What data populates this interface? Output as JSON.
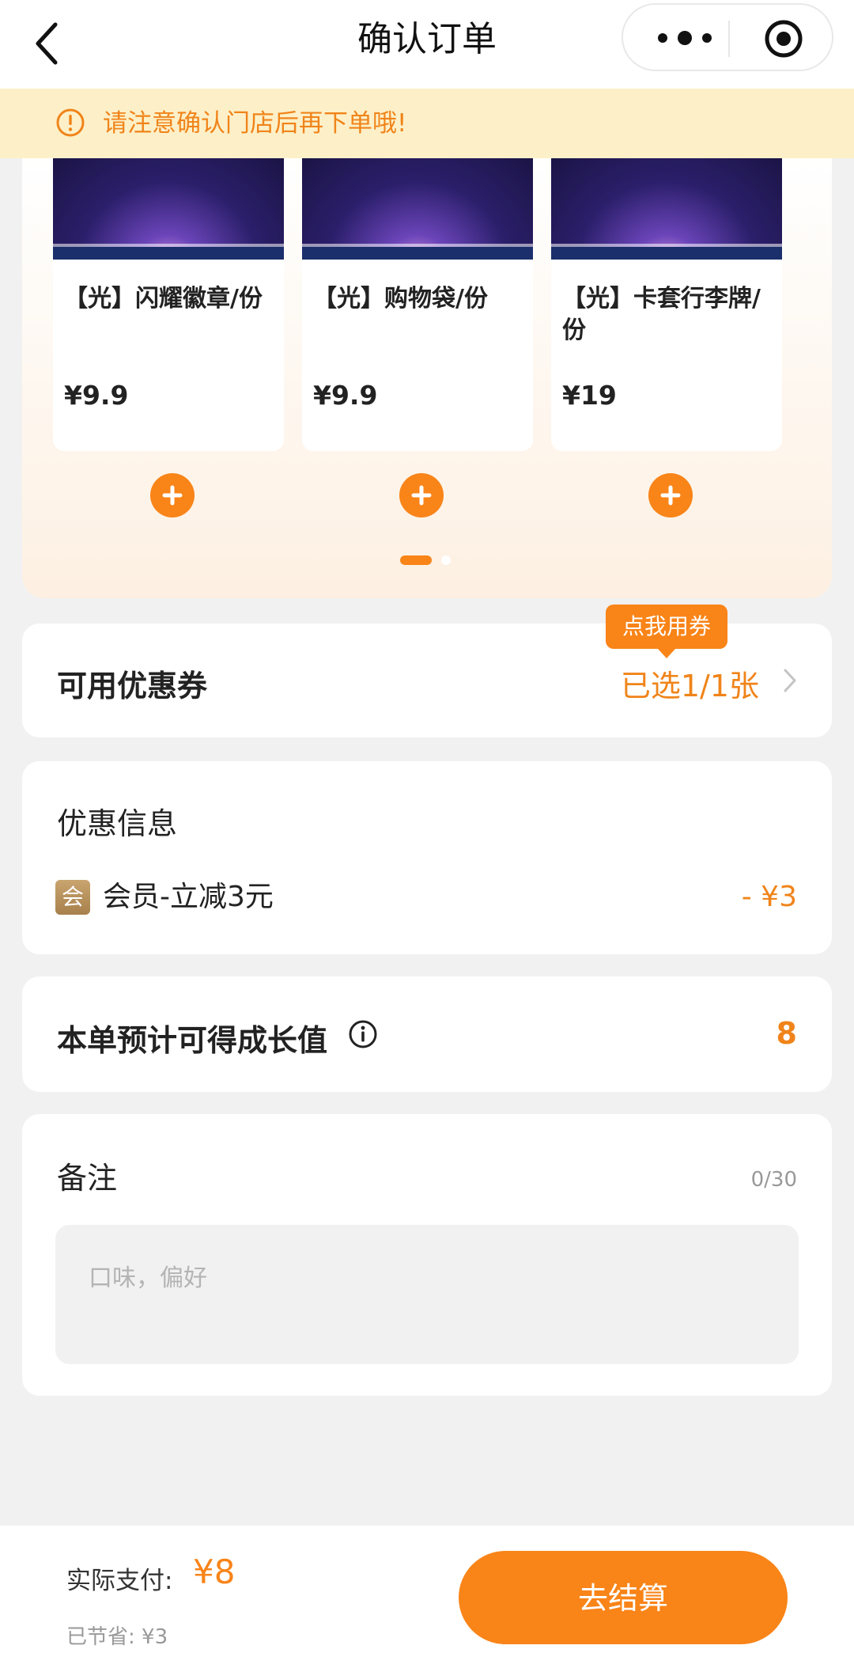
{
  "nav": {
    "title": "确认订单"
  },
  "notice": {
    "text": "请注意确认门店后再下单哦!"
  },
  "promo": {
    "products": [
      {
        "name": "【光】闪耀徽章/份",
        "price": "¥9.9"
      },
      {
        "name": "【光】购物袋/份",
        "price": "¥9.9"
      },
      {
        "name": "【光】卡套行李牌/份",
        "price": "¥19"
      }
    ],
    "pager": {
      "current": 1,
      "total": 2
    }
  },
  "coupon": {
    "label": "可用优惠券",
    "value": "已选1/1张",
    "tip": "点我用券"
  },
  "discount": {
    "title": "优惠信息",
    "badge": "会",
    "item_label": "会员-立减3元",
    "item_amount": "- ¥3"
  },
  "growth": {
    "label": "本单预计可得成长值",
    "value": "8"
  },
  "remark": {
    "label": "备注",
    "count": "0/30",
    "placeholder": "口味，偏好"
  },
  "footer": {
    "pay_label": "实际支付:",
    "pay_value": "¥8",
    "saved": "已节省: ¥3",
    "checkout_label": "去结算"
  },
  "colors": {
    "accent": "#f98418",
    "notice_bg": "#fdf0c8",
    "member_badge": "#b58c59"
  }
}
